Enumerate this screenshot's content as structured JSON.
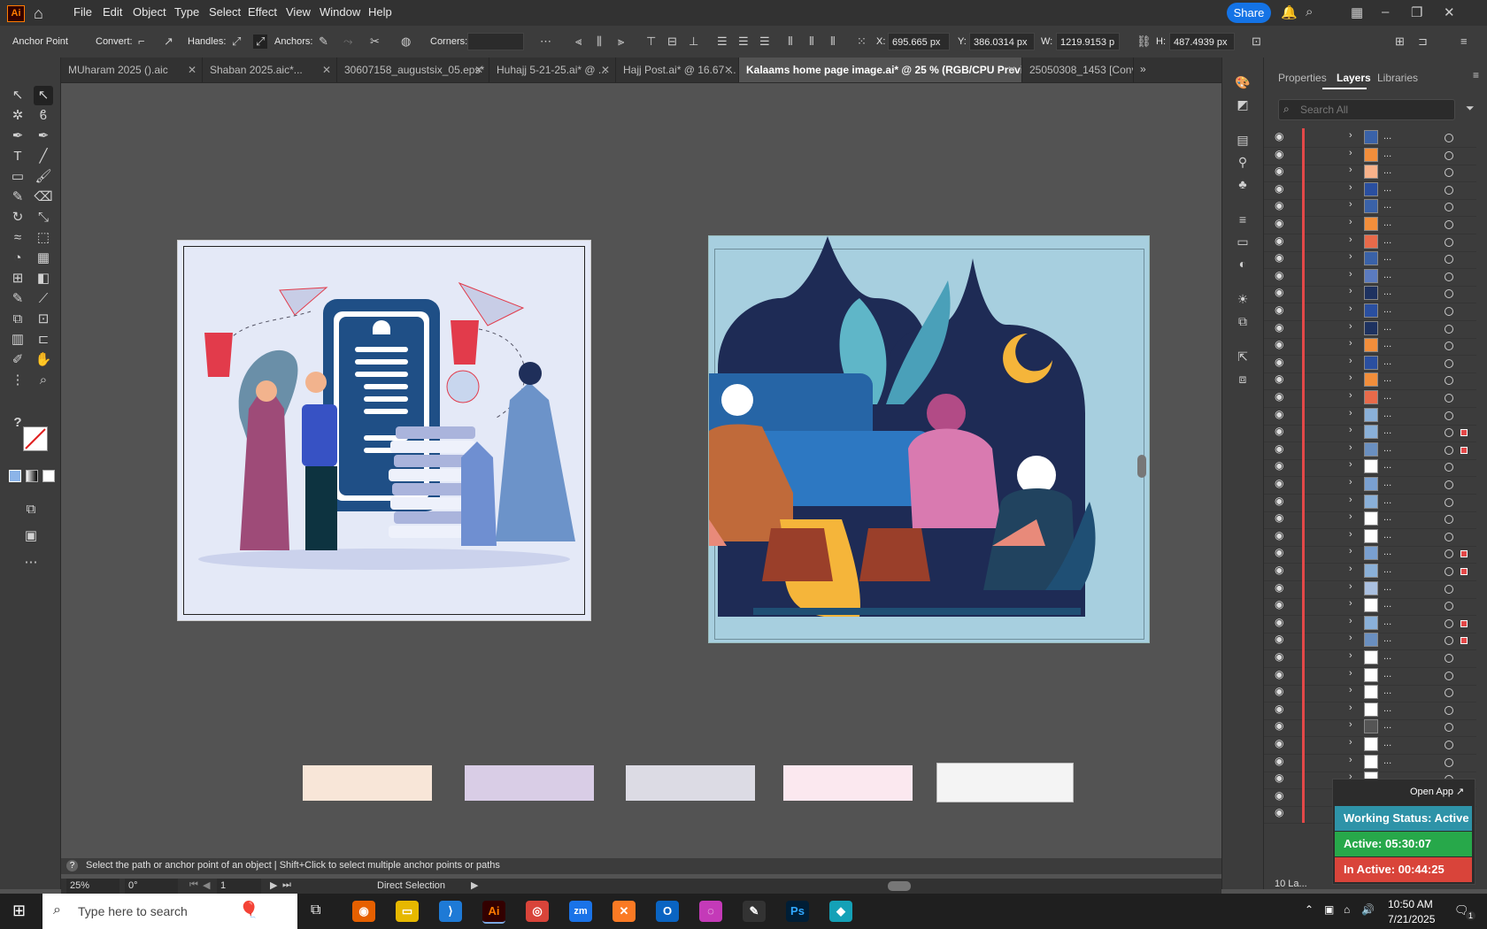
{
  "app": {
    "logo": "Ai"
  },
  "menu": [
    "File",
    "Edit",
    "Object",
    "Type",
    "Select",
    "Effect",
    "View",
    "Window",
    "Help"
  ],
  "share_label": "Share",
  "control": {
    "tool_name": "Anchor Point",
    "convert": "Convert:",
    "handles": "Handles:",
    "anchors": "Anchors:",
    "corners": "Corners:",
    "x_label": "X:",
    "x_value": "695.665 px",
    "y_label": "Y:",
    "y_value": "386.0314 px",
    "w_label": "W:",
    "w_value": "1219.9153 p",
    "h_label": "H:",
    "h_value": "487.4939 px"
  },
  "tabs": [
    {
      "label": "MUharam 2025 ().aic"
    },
    {
      "label": "Shaban 2025.aic*..."
    },
    {
      "label": "30607158_augustsix_05.eps*"
    },
    {
      "label": "Huhajj 5-21-25.ai* @ ..."
    },
    {
      "label": "Hajj Post.ai* @ 16.67 ..."
    },
    {
      "label": "Kalaams home page image.ai* @ 25 % (RGB/CPU Preview)"
    },
    {
      "label": "25050308_1453 [Conv"
    }
  ],
  "panel": {
    "tabs": [
      "Properties",
      "Layers",
      "Libraries"
    ],
    "active_tab": "Layers",
    "search_placeholder": "Search All",
    "layers_count": "10 La...",
    "row_label": "..."
  },
  "status": {
    "hint": "Select the path or anchor point of an object  |  Shift+Click to select multiple anchor points or paths",
    "zoom": "25%",
    "rotation": "0°",
    "artboard": "1",
    "tool": "Direct Selection"
  },
  "widget": {
    "open_app": "Open App ↗",
    "working": "Working Status: Active",
    "active": "Active: 05:30:07",
    "inactive": "In Active: 00:44:25"
  },
  "taskbar": {
    "search_placeholder": "Type here to search",
    "time": "10:50 AM",
    "date": "7/21/2025",
    "notifications": "1"
  },
  "colors": {
    "accent": "#1473e6",
    "ai_brand": "#ff7c00",
    "layer_color": "#e34848",
    "active_green": "#27a84a",
    "inactive_red": "#d9443a",
    "working_teal": "#2e93a8"
  }
}
